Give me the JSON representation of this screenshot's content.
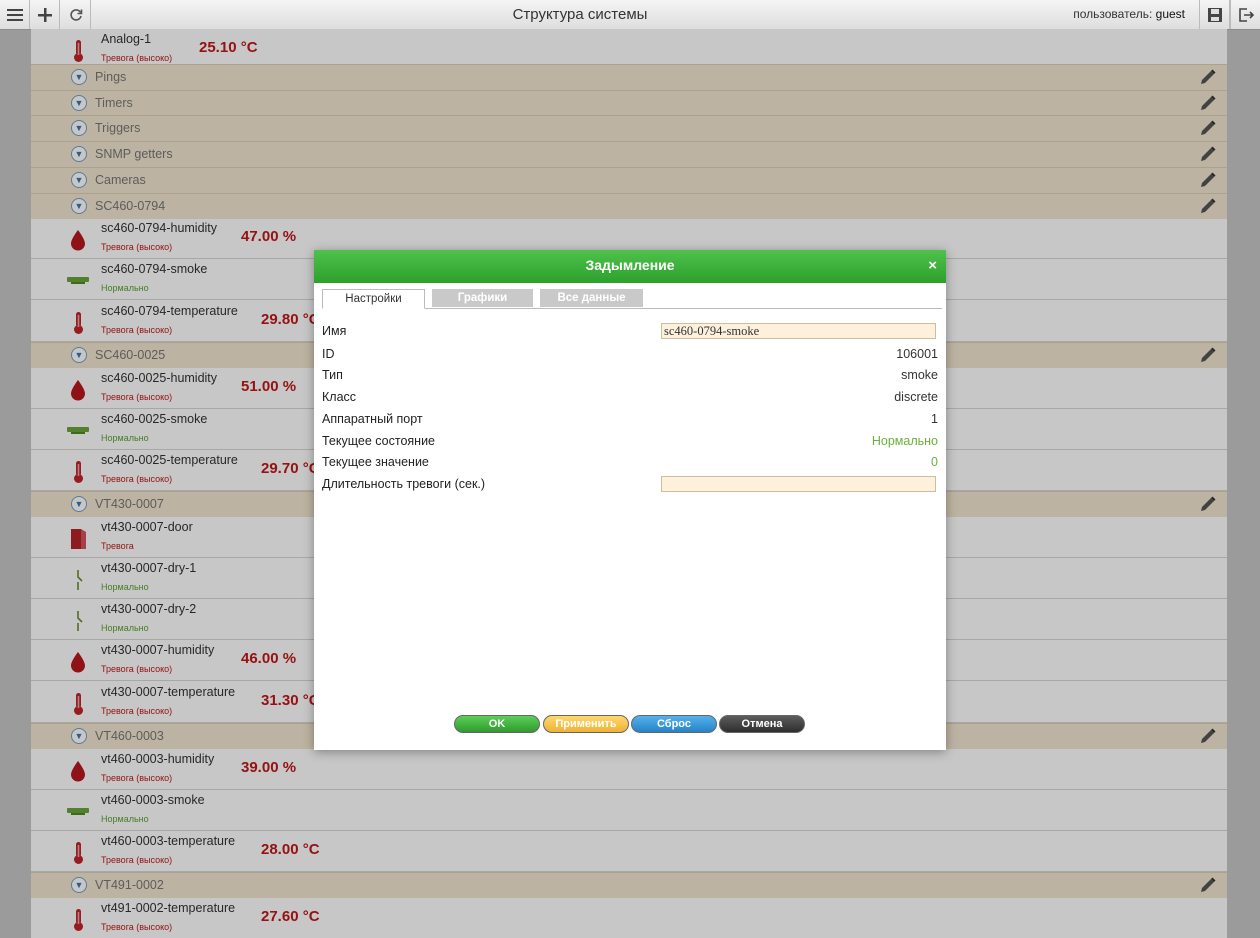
{
  "topbar": {
    "title": "Структура системы",
    "user_label": "пользователь:",
    "user_name": "guest",
    "icons": [
      "menu-icon",
      "plus-icon",
      "refresh-icon",
      "save-icon",
      "logout-icon"
    ]
  },
  "list": {
    "rows": [
      {
        "kind": "sensor",
        "icon": "thermometer-icon",
        "name": "Analog-1",
        "status": "Тревога (высоко)",
        "state": "alarm",
        "value": "25.10 °C"
      },
      {
        "kind": "group",
        "name": "Pings"
      },
      {
        "kind": "group",
        "name": "Timers"
      },
      {
        "kind": "group",
        "name": "Triggers"
      },
      {
        "kind": "group",
        "name": "SNMP getters"
      },
      {
        "kind": "group",
        "name": "Cameras"
      },
      {
        "kind": "group",
        "name": "SC460-0794"
      },
      {
        "kind": "sensor",
        "icon": "humidity-drop-icon",
        "name": "sc460-0794-humidity",
        "status": "Тревога (высоко)",
        "state": "alarm",
        "value": "47.00 %"
      },
      {
        "kind": "sensor",
        "icon": "smoke-detector-icon",
        "name": "sc460-0794-smoke",
        "status": "Нормально",
        "state": "ok",
        "value": ""
      },
      {
        "kind": "sensor",
        "icon": "thermometer-icon",
        "name": "sc460-0794-temperature",
        "status": "Тревога (высоко)",
        "state": "alarm",
        "value": "29.80 °C"
      },
      {
        "kind": "group",
        "name": "SC460-0025"
      },
      {
        "kind": "sensor",
        "icon": "humidity-drop-icon",
        "name": "sc460-0025-humidity",
        "status": "Тревога (высоко)",
        "state": "alarm",
        "value": "51.00 %"
      },
      {
        "kind": "sensor",
        "icon": "smoke-detector-icon",
        "name": "sc460-0025-smoke",
        "status": "Нормально",
        "state": "ok",
        "value": ""
      },
      {
        "kind": "sensor",
        "icon": "thermometer-icon",
        "name": "sc460-0025-temperature",
        "status": "Тревога (высоко)",
        "state": "alarm",
        "value": "29.70 °C"
      },
      {
        "kind": "group",
        "name": "VT430-0007"
      },
      {
        "kind": "sensor",
        "icon": "door-icon",
        "name": "vt430-0007-door",
        "status": "Тревога",
        "state": "alarm",
        "value": ""
      },
      {
        "kind": "sensor",
        "icon": "dry-contact-icon",
        "name": "vt430-0007-dry-1",
        "status": "Нормально",
        "state": "ok",
        "value": ""
      },
      {
        "kind": "sensor",
        "icon": "dry-contact-icon",
        "name": "vt430-0007-dry-2",
        "status": "Нормально",
        "state": "ok",
        "value": ""
      },
      {
        "kind": "sensor",
        "icon": "humidity-drop-icon",
        "name": "vt430-0007-humidity",
        "status": "Тревога (высоко)",
        "state": "alarm",
        "value": "46.00 %"
      },
      {
        "kind": "sensor",
        "icon": "thermometer-icon",
        "name": "vt430-0007-temperature",
        "status": "Тревога (высоко)",
        "state": "alarm",
        "value": "31.30 °C"
      },
      {
        "kind": "group",
        "name": "VT460-0003"
      },
      {
        "kind": "sensor",
        "icon": "humidity-drop-icon",
        "name": "vt460-0003-humidity",
        "status": "Тревога (высоко)",
        "state": "alarm",
        "value": "39.00 %"
      },
      {
        "kind": "sensor",
        "icon": "smoke-detector-icon",
        "name": "vt460-0003-smoke",
        "status": "Нормально",
        "state": "ok",
        "value": ""
      },
      {
        "kind": "sensor",
        "icon": "thermometer-icon",
        "name": "vt460-0003-temperature",
        "status": "Тревога (высоко)",
        "state": "alarm",
        "value": "28.00 °C"
      },
      {
        "kind": "group",
        "name": "VT491-0002"
      },
      {
        "kind": "sensor",
        "icon": "thermometer-icon",
        "name": "vt491-0002-temperature",
        "status": "Тревога (высоко)",
        "state": "alarm",
        "value": "27.60 °C"
      }
    ]
  },
  "dialog": {
    "title": "Задымление",
    "close": "×",
    "tabs": [
      "Настройки",
      "Графики",
      "Все данные"
    ],
    "fields": {
      "name_label": "Имя",
      "name_value": "sc460-0794-smoke",
      "id_label": "ID",
      "id_value": "106001",
      "type_label": "Тип",
      "type_value": "smoke",
      "class_label": "Класс",
      "class_value": "discrete",
      "port_label": "Аппаратный порт",
      "port_value": "1",
      "state_label": "Текущее состояние",
      "state_value": "Нормально",
      "value_label": "Текущее значение",
      "value_value": "0",
      "duration_label": "Длительность тревоги (сек.)",
      "duration_value": ""
    },
    "buttons": {
      "ok": "OK",
      "apply": "Применить",
      "reset": "Сброс",
      "cancel": "Отмена"
    },
    "colors": {
      "header": "#3bb03a",
      "ok": "#3aa53a",
      "apply": "#f2c04a",
      "reset": "#2f8fcf",
      "cancel": "#3b3b3b"
    }
  }
}
